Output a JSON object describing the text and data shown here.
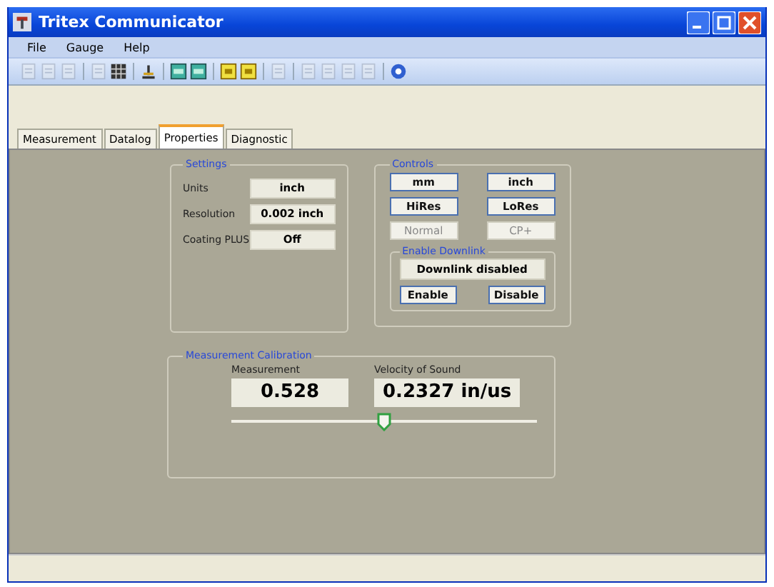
{
  "window": {
    "title": "Tritex Communicator"
  },
  "menu": [
    "File",
    "Gauge",
    "Help"
  ],
  "toolbar": [
    {
      "kind": "doc",
      "disabled": true
    },
    {
      "kind": "doc",
      "disabled": true
    },
    {
      "kind": "doc",
      "disabled": true
    },
    {
      "kind": "sep"
    },
    {
      "kind": "doc",
      "disabled": true
    },
    {
      "kind": "grid",
      "disabled": false
    },
    {
      "kind": "sep"
    },
    {
      "kind": "antenna",
      "disabled": false
    },
    {
      "kind": "sep"
    },
    {
      "kind": "green",
      "disabled": false
    },
    {
      "kind": "green",
      "disabled": false
    },
    {
      "kind": "sep"
    },
    {
      "kind": "yellow",
      "disabled": false
    },
    {
      "kind": "yellow",
      "disabled": false
    },
    {
      "kind": "sep"
    },
    {
      "kind": "doc",
      "disabled": true
    },
    {
      "kind": "sep"
    },
    {
      "kind": "doc",
      "disabled": true
    },
    {
      "kind": "doc",
      "disabled": true
    },
    {
      "kind": "doc",
      "disabled": true
    },
    {
      "kind": "doc",
      "disabled": true
    },
    {
      "kind": "sep"
    },
    {
      "kind": "help",
      "disabled": false
    }
  ],
  "tabs": [
    {
      "label": "Measurement",
      "selected": false
    },
    {
      "label": "Datalog",
      "selected": false
    },
    {
      "label": "Properties",
      "selected": true
    },
    {
      "label": "Diagnostic",
      "selected": false
    }
  ],
  "settings": {
    "title": "Settings",
    "rows": [
      {
        "label": "Units",
        "value": "inch"
      },
      {
        "label": "Resolution",
        "value": "0.002 inch"
      },
      {
        "label": "Coating PLUS",
        "value": "Off"
      }
    ]
  },
  "controls": {
    "title": "Controls",
    "buttons": [
      {
        "label": "mm",
        "disabled": false
      },
      {
        "label": "inch",
        "disabled": false
      },
      {
        "label": "HiRes",
        "disabled": false
      },
      {
        "label": "LoRes",
        "disabled": false
      },
      {
        "label": "Normal",
        "disabled": true
      },
      {
        "label": "CP+",
        "disabled": true
      }
    ],
    "downlink": {
      "title": "Enable Downlink",
      "status": "Downlink disabled",
      "buttons": [
        {
          "label": "Enable",
          "disabled": false
        },
        {
          "label": "Disable",
          "disabled": false
        }
      ]
    }
  },
  "calibration": {
    "title": "Measurement Calibration",
    "measurement_label": "Measurement",
    "measurement": "0.528",
    "velocity_label": "Velocity of Sound",
    "velocity": "0.2327 in/us",
    "slider": {
      "level": 0.5
    }
  }
}
